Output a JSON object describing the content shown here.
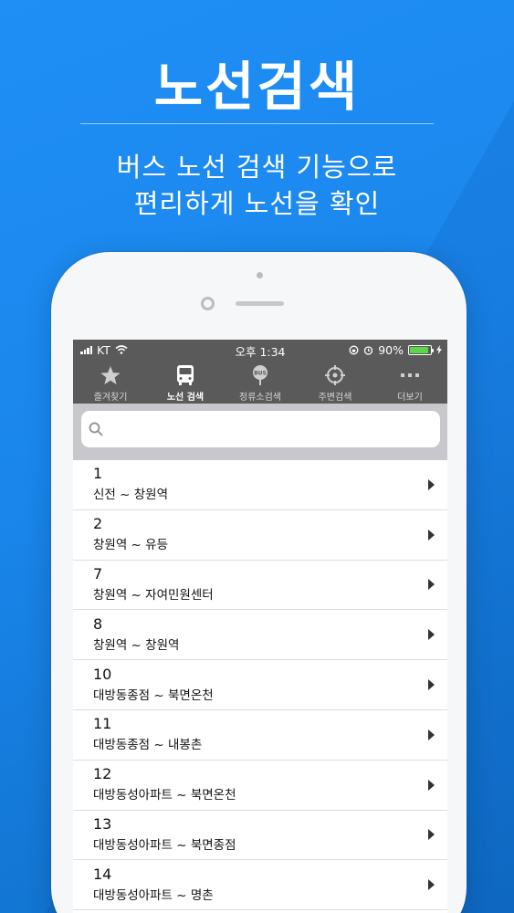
{
  "headline": "노선검색",
  "subtitle_line1": "버스 노선 검색 기능으로",
  "subtitle_line2": "편리하게 노선을 확인",
  "status_bar": {
    "carrier": "KT",
    "time": "오후 1:34",
    "battery_percent": "90%",
    "battery_level": 0.9
  },
  "tabs": [
    {
      "label": "즐겨찾기",
      "icon": "star-icon"
    },
    {
      "label": "노선 검색",
      "icon": "bus-icon",
      "active": true
    },
    {
      "label": "정류소검색",
      "icon": "bus-stop-icon"
    },
    {
      "label": "주변검색",
      "icon": "crosshair-icon"
    },
    {
      "label": "더보기",
      "icon": "more-dots-icon"
    }
  ],
  "search": {
    "placeholder": "",
    "value": ""
  },
  "routes": [
    {
      "number": "1",
      "route": "신전 ~ 창원역"
    },
    {
      "number": "2",
      "route": "창원역 ~ 유등"
    },
    {
      "number": "7",
      "route": "창원역 ~ 자여민원센터"
    },
    {
      "number": "8",
      "route": "창원역 ~ 창원역"
    },
    {
      "number": "10",
      "route": "대방동종점 ~ 북면온천"
    },
    {
      "number": "11",
      "route": "대방동종점 ~ 내봉촌"
    },
    {
      "number": "12",
      "route": "대방동성아파트 ~ 북면온천"
    },
    {
      "number": "13",
      "route": "대방동성아파트 ~ 북면종점"
    },
    {
      "number": "14",
      "route": "대방동성아파트 ~ 명촌"
    }
  ],
  "colors": {
    "background": "#1a86ec",
    "bar": "#5a5a5a",
    "battery": "#5bd54a"
  }
}
